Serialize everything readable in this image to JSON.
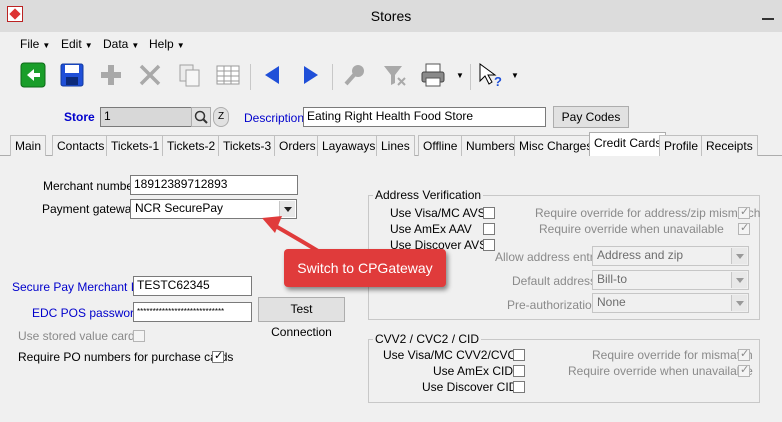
{
  "window": {
    "title": "Stores"
  },
  "menu": {
    "file": "File",
    "edit": "Edit",
    "data": "Data",
    "help": "Help"
  },
  "store": {
    "store_label": "Store",
    "store_value": "1",
    "description_label": "Description",
    "description_value": "Eating Right Health Food Store",
    "pay_codes_button": "Pay Codes"
  },
  "tabs": [
    "Main",
    "Contacts",
    "Tickets-1",
    "Tickets-2",
    "Tickets-3",
    "Orders",
    "Layaways",
    "Lines",
    "Offline",
    "Numbers",
    "Misc Charges",
    "Credit Cards",
    "Profile",
    "Receipts"
  ],
  "active_tab": "Credit Cards",
  "credit": {
    "merchant_number_label": "Merchant number",
    "merchant_number_value": "18912389712893",
    "payment_gateway_label": "Payment gateway",
    "payment_gateway_value": "NCR SecurePay",
    "secure_pay_merchant_label": "Secure Pay Merchant Id",
    "secure_pay_merchant_value": "TESTC62345",
    "edc_pos_password_label": "EDC POS password",
    "edc_pos_password_value": "****************************",
    "test_connection_button": "Test Connection",
    "use_stored_value_label": "Use stored value cards",
    "require_po_label": "Require PO numbers for purchase cards",
    "require_po_checked": true
  },
  "address_verification": {
    "title": "Address Verification",
    "use_visa_mc_avs": "Use Visa/MC AVS",
    "use_amex_aav": "Use AmEx AAV",
    "use_discover_avs": "Use Discover AVS",
    "require_override_mismatch": "Require override for address/zip mismatch",
    "require_override_unavailable": "Require override when unavailable",
    "allow_address_entry_label": "Allow address entry",
    "allow_address_entry_value": "Address and zip",
    "default_address_label": "Default address",
    "default_address_value": "Bill-to",
    "pre_authorization_label": "Pre-authorization",
    "pre_authorization_value": "None"
  },
  "cvv": {
    "title": "CVV2 / CVC2 / CID",
    "use_visa_mc_cvv2": "Use Visa/MC CVV2/CVC2",
    "use_amex_cid": "Use AmEx CID",
    "use_discover_cid": "Use Discover CID",
    "require_override_mismatch": "Require override for mismatch",
    "require_override_unavailable": "Require override when unavailable"
  },
  "annotation": {
    "text": "Switch to CPGateway",
    "color": "#e03b3b"
  },
  "colors": {
    "link_blue": "#0000cc",
    "nav_blue": "#1f4fd8",
    "back_green": "#1a9e2a"
  }
}
